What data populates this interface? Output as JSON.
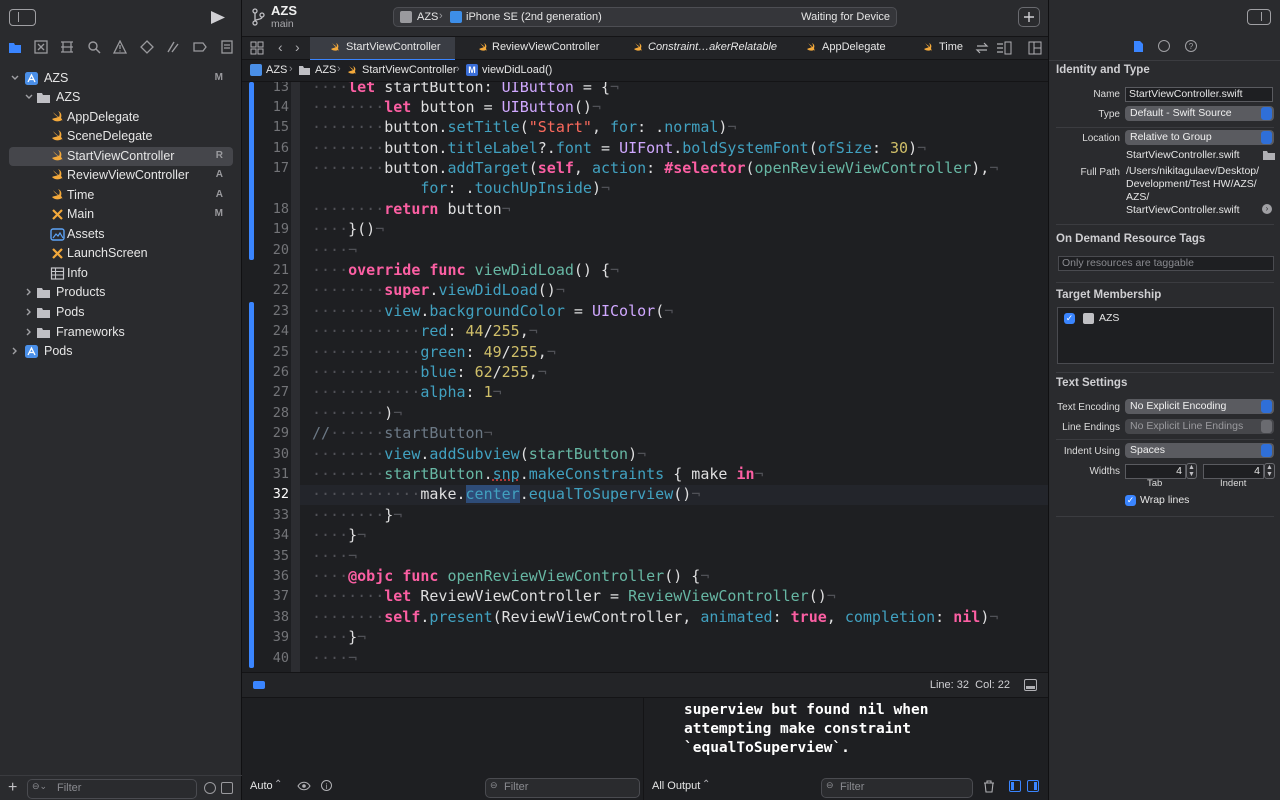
{
  "toolbar": {
    "project_name": "AZS",
    "branch": "main",
    "scheme": "AZS",
    "device": "iPhone SE (2nd generation)",
    "status": "Waiting for Device"
  },
  "navigator": {
    "items": [
      {
        "label": "AZS",
        "status": "M"
      },
      {
        "label": "AZS",
        "status": ""
      },
      {
        "label": "AppDelegate",
        "status": ""
      },
      {
        "label": "SceneDelegate",
        "status": ""
      },
      {
        "label": "StartViewController",
        "status": "R"
      },
      {
        "label": "ReviewViewController",
        "status": "A"
      },
      {
        "label": "Time",
        "status": "A"
      },
      {
        "label": "Main",
        "status": "M"
      },
      {
        "label": "Assets",
        "status": ""
      },
      {
        "label": "LaunchScreen",
        "status": ""
      },
      {
        "label": "Info",
        "status": ""
      },
      {
        "label": "Products",
        "status": ""
      },
      {
        "label": "Pods",
        "status": ""
      },
      {
        "label": "Frameworks",
        "status": ""
      },
      {
        "label": "Pods",
        "status": ""
      }
    ],
    "filter_placeholder": "Filter"
  },
  "tabs": [
    {
      "label": "StartViewController"
    },
    {
      "label": "ReviewViewController"
    },
    {
      "label": "Constraint…akerRelatable"
    },
    {
      "label": "AppDelegate"
    },
    {
      "label": "Time"
    }
  ],
  "jumpbar": {
    "crumbs": [
      "AZS",
      "AZS",
      "StartViewController",
      "viewDidLoad()"
    ]
  },
  "editor": {
    "line_numbers": [
      "13",
      "14",
      "15",
      "16",
      "17",
      "",
      "18",
      "19",
      "20",
      "21",
      "22",
      "23",
      "24",
      "25",
      "26",
      "27",
      "28",
      "29",
      "30",
      "31",
      "32",
      "33",
      "34",
      "35",
      "36",
      "37",
      "38",
      "39",
      "40"
    ],
    "current_line": "32"
  },
  "status": {
    "position": "Line: 32  Col: 22"
  },
  "debug": {
    "auto_label": "Auto",
    "left_filter": "Filter",
    "output_label": "All Output",
    "right_filter": "Filter",
    "console_text": [
      "superview but found nil when",
      "attempting make constraint",
      "`equalToSuperview`."
    ]
  },
  "inspector": {
    "identity_title": "Identity and Type",
    "name_label": "Name",
    "name_value": "StartViewController.swift",
    "type_label": "Type",
    "type_value": "Default - Swift Source",
    "location_label": "Location",
    "location_value": "Relative to Group",
    "location_file": "StartViewController.swift",
    "fullpath_label": "Full Path",
    "fullpath_lines": [
      "/Users/nikitagulaev/Desktop/",
      "Development/Test HW/AZS/",
      "AZS/",
      "StartViewController.swift"
    ],
    "ondemand_title": "On Demand Resource Tags",
    "ondemand_placeholder": "Only resources are taggable",
    "target_title": "Target Membership",
    "target_name": "AZS",
    "text_title": "Text Settings",
    "encoding_label": "Text Encoding",
    "encoding_value": "No Explicit Encoding",
    "endings_label": "Line Endings",
    "endings_value": "No Explicit Line Endings",
    "indent_label": "Indent Using",
    "indent_value": "Spaces",
    "widths_label": "Widths",
    "tab_width": "4",
    "indent_width": "4",
    "tab_caption": "Tab",
    "indent_caption": "Indent",
    "wrap_label": "Wrap lines"
  }
}
